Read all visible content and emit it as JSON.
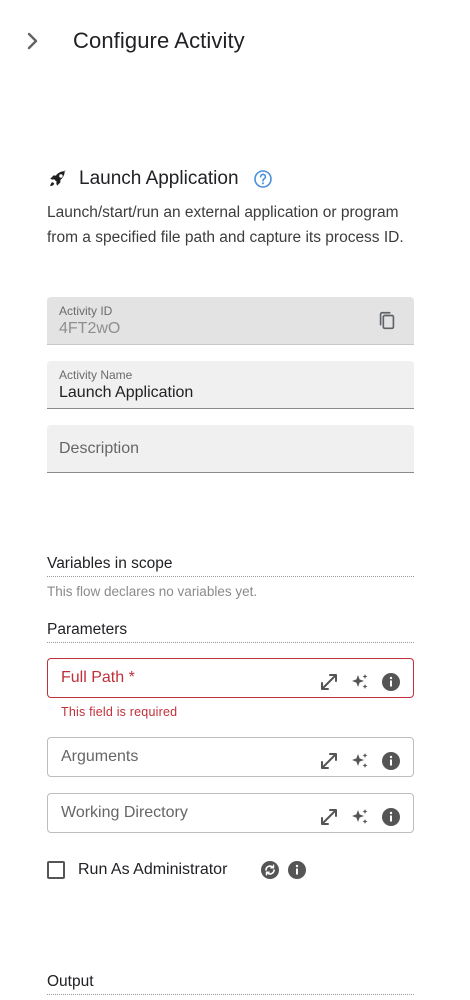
{
  "header": {
    "title": "Configure Activity",
    "back_icon": "chevron-right-icon"
  },
  "activity": {
    "icon": "rocket-icon",
    "title": "Launch Application",
    "help_icon": "help-circle-icon",
    "description": "Launch/start/run an external application or program from a specified file path and capture its process ID."
  },
  "fields": {
    "activity_id": {
      "label": "Activity ID",
      "value": "4FT2wO",
      "icon": "copy-icon"
    },
    "activity_name": {
      "label": "Activity Name",
      "value": "Launch Application"
    },
    "description": {
      "placeholder": "Description"
    }
  },
  "variables": {
    "title": "Variables in scope",
    "note": "This flow declares no variables yet."
  },
  "parameters": {
    "title": "Parameters",
    "full_path": {
      "label": "Full Path *",
      "error": "This field is required"
    },
    "arguments": {
      "label": "Arguments"
    },
    "working_directory": {
      "label": "Working Directory"
    },
    "run_as_admin": {
      "label": "Run As Administrator",
      "checked": false
    }
  },
  "output": {
    "title": "Output"
  },
  "colors": {
    "accent": "#4a90d9",
    "error": "#c0303a",
    "icon_gray": "#555555"
  }
}
